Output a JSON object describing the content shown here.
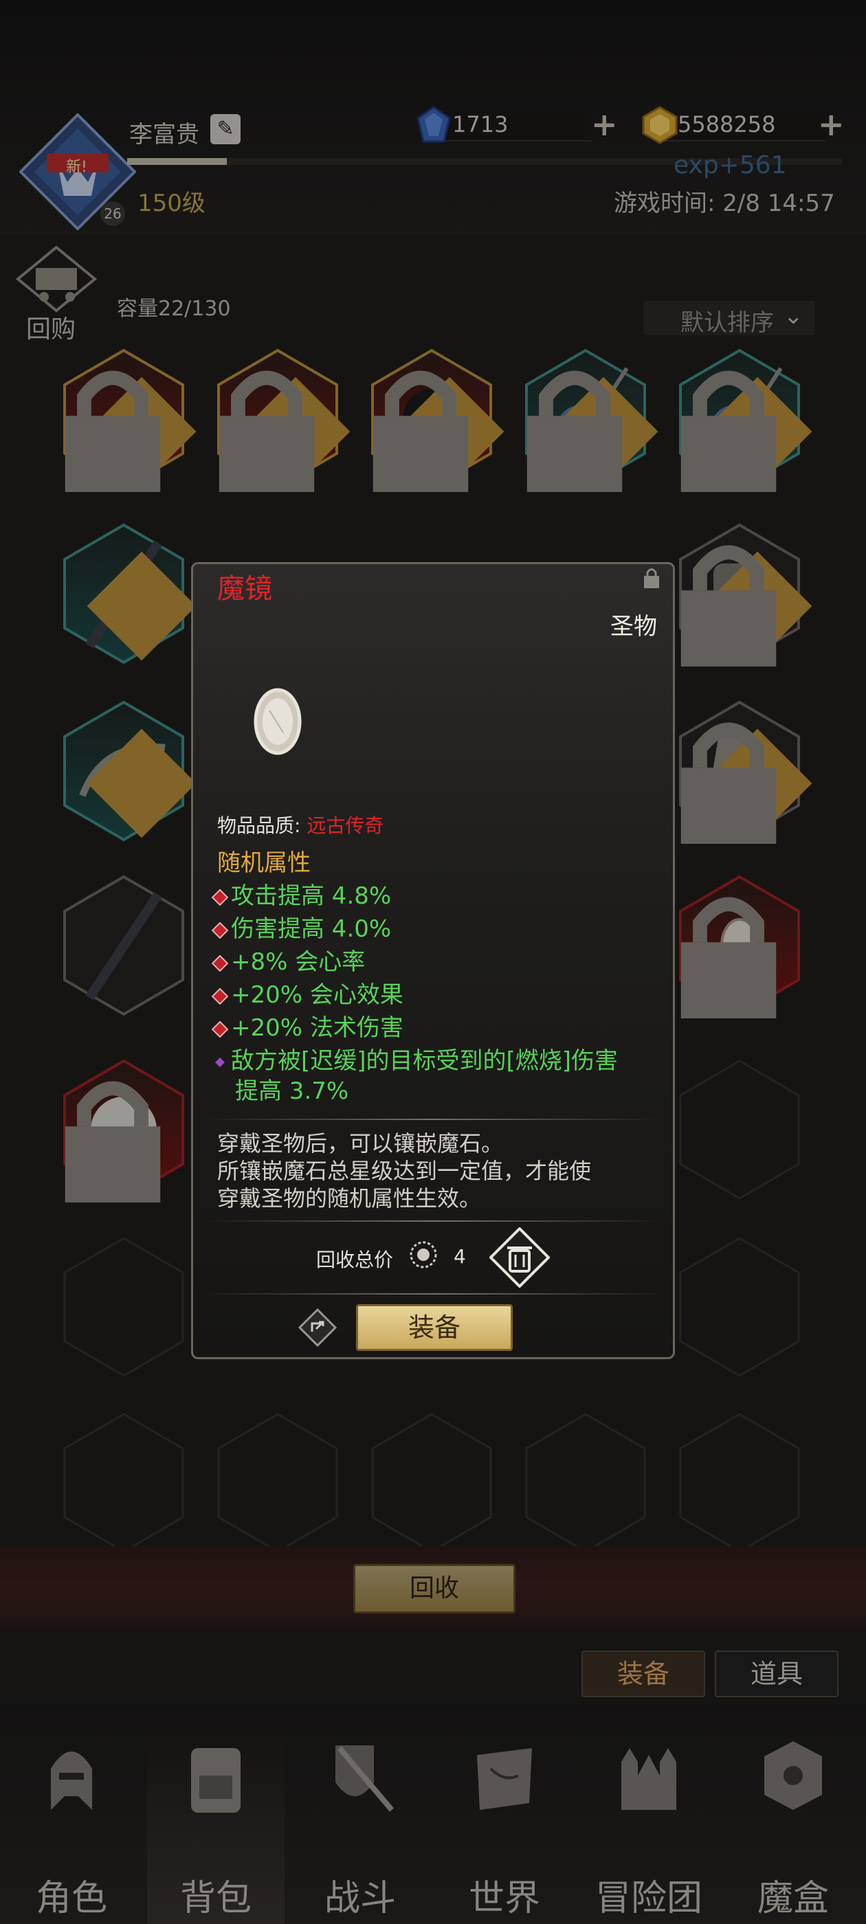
{
  "player": {
    "name": "李富贵",
    "level": "150级",
    "avatar_badge": "新!",
    "avatar_rank": "26"
  },
  "resources": {
    "gems": "1713",
    "gold": "5588258"
  },
  "exp_gain": "exp+561",
  "game_time": "游戏时间: 2/8 14:57",
  "inventory": {
    "recycle_label": "回购",
    "capacity": "容量22/130",
    "sort_label": "默认排序"
  },
  "recycle_button": "回收",
  "tabs": {
    "equip": "装备",
    "items": "道具"
  },
  "nav": [
    "角色",
    "背包",
    "战斗",
    "世界",
    "冒险团",
    "魔盒"
  ],
  "popup": {
    "name": "魔镜",
    "type": "圣物",
    "quality_label": "物品品质:",
    "quality_value": "远古传奇",
    "random_attr_title": "随机属性",
    "attributes": [
      "攻击提高 4.8%",
      "伤害提高 4.0%",
      "+8% 会心率",
      "+20% 会心效果",
      "+20% 法术伤害"
    ],
    "special_attr_line1": "敌方被[迟缓]的目标受到的[燃烧]伤害",
    "special_attr_line2": "提高 3.7%",
    "desc_line1": "穿戴圣物后，可以镶嵌魔石。",
    "desc_line2": "所镶嵌魔石总星级达到一定值，才能使",
    "desc_line3": "穿戴圣物的随机属性生效。",
    "recycle_total_label": "回收总价",
    "recycle_total_value": "4",
    "equip_button": "装备"
  },
  "colors": {
    "legendary": "#e0242a",
    "attr_green": "#58d25a",
    "gold_accent": "#e0a93a"
  },
  "icons": [
    "edit-icon",
    "gem-icon",
    "gold-icon",
    "cart-icon",
    "lock-icon",
    "trash-icon",
    "share-icon",
    "coin-icon",
    "mirror-icon"
  ]
}
